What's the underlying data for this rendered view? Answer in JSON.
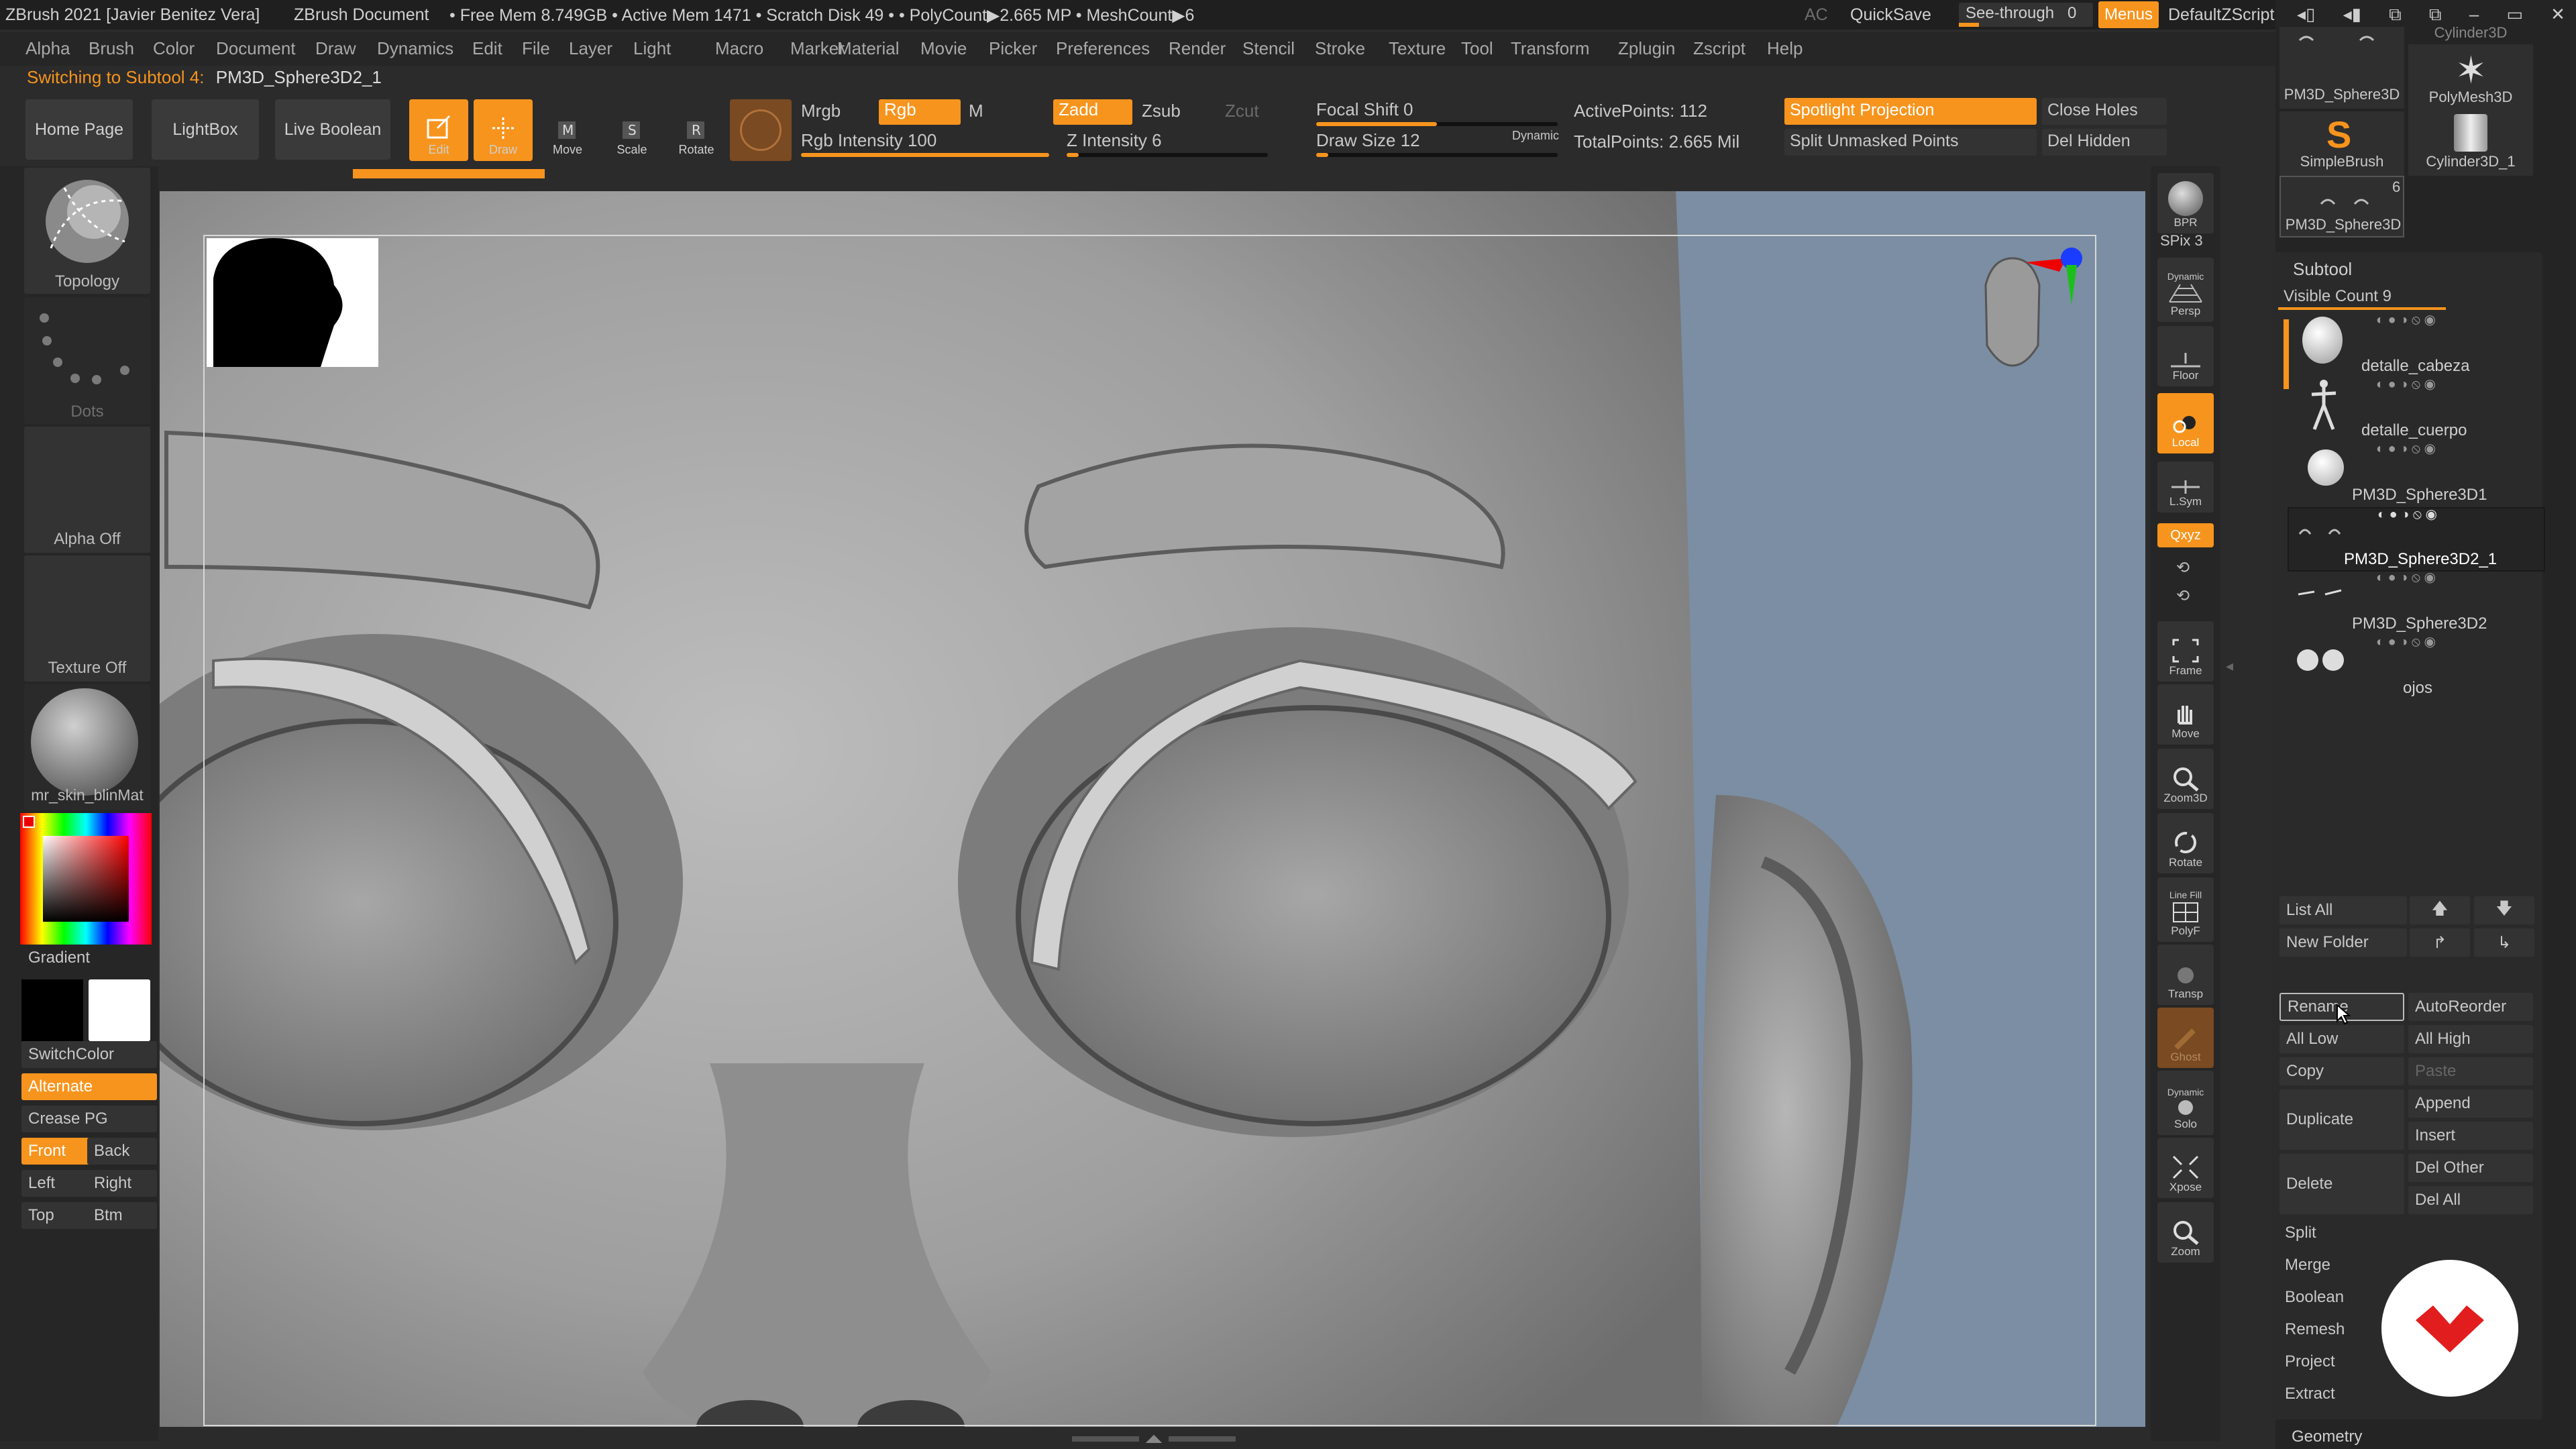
{
  "titlebar": {
    "app": "ZBrush 2021 [Javier Benitez Vera]",
    "doc": "ZBrush Document",
    "stats": "• Free Mem 8.749GB • Active Mem 1471 • Scratch Disk 49 • • PolyCount▶2.665 MP • MeshCount▶6",
    "ac": "AC",
    "quicksave": "QuickSave",
    "seethrough": "See-through",
    "seethrough_value": "0",
    "menus": "Menus",
    "script": "DefaultZScript"
  },
  "menubar": [
    "Alpha",
    "Brush",
    "Color",
    "Document",
    "Draw",
    "Dynamics",
    "Edit",
    "File",
    "Layer",
    "Light",
    "Macro",
    "Marker",
    "Material",
    "Movie",
    "Picker",
    "Preferences",
    "Render",
    "Stencil",
    "Stroke",
    "Texture",
    "Tool",
    "Transform",
    "Zplugin",
    "Zscript",
    "Help"
  ],
  "switch": {
    "label": "Switching to Subtool 4:",
    "value": "PM3D_Sphere3D2_1"
  },
  "toolbar": {
    "home": "Home Page",
    "lightbox": "LightBox",
    "liveboolean": "Live Boolean",
    "edit": "Edit",
    "draw": "Draw",
    "move": "Move",
    "scale": "Scale",
    "rotate": "Rotate",
    "mrgb": "Mrgb",
    "rgb": "Rgb",
    "m": "M",
    "rgb_intensity": "Rgb Intensity 100",
    "zadd": "Zadd",
    "zsub": "Zsub",
    "zcut": "Zcut",
    "z_intensity": "Z Intensity 6",
    "focal_shift": "Focal Shift 0",
    "draw_size": "Draw Size 12",
    "dynamic": "Dynamic",
    "active_points": "ActivePoints: 112",
    "total_points": "TotalPoints: 2.665 Mil",
    "spotlight": "Spotlight Projection",
    "split_unmasked": "Split Unmasked Points",
    "close_holes": "Close Holes",
    "del_hidden": "Del Hidden",
    "rgb_intensity_level": 1.0,
    "z_intensity_level": 0.06,
    "draw_size_level": 0.05,
    "focal_shift_level": 0.5
  },
  "leftpanel": {
    "topology": "Topology",
    "dots": "Dots",
    "alpha": "Alpha Off",
    "texture": "Texture Off",
    "material": "mr_skin_blinMat",
    "gradient": "Gradient",
    "switchcolor": "SwitchColor",
    "alternate": "Alternate",
    "crease": "Crease PG",
    "front": "Front",
    "back": "Back",
    "left": "Left",
    "right": "Right",
    "top": "Top",
    "btm": "Btm"
  },
  "righttools": {
    "bpr": "BPR",
    "spix": "SPix 3",
    "dynamic": "Dynamic",
    "persp": "Persp",
    "floor": "Floor",
    "local": "Local",
    "lsym": "L.Sym",
    "xyz": "Qxyz",
    "frame": "Frame",
    "move": "Move",
    "zoom3d": "Zoom3D",
    "rotate": "Rotate",
    "linefill": "Line Fill",
    "polyf": "PolyF",
    "transp": "Transp",
    "ghost": "Ghost",
    "dynamic2": "Dynamic",
    "solo": "Solo",
    "xpose": "Xpose",
    "zoom": "Zoom"
  },
  "rightpanel": {
    "thumbs": {
      "pm3d_sphere": "PM3D_Sphere3D",
      "polymesh": "PolyMesh3D",
      "simplebrush": "SimpleBrush",
      "cylinder": "Cylinder3D_1",
      "cylinder_top": "Cylinder3D",
      "pm3d_sphere2": "PM3D_Sphere3D",
      "count": "6"
    },
    "subtool_title": "Subtool",
    "visible_count": "Visible Count 9",
    "subtools": [
      "detalle_cabeza",
      "detalle_cuerpo",
      "PM3D_Sphere3D1",
      "PM3D_Sphere3D2_1",
      "PM3D_Sphere3D2",
      "ojos"
    ],
    "buttons": {
      "list_all": "List All",
      "new_folder": "New Folder",
      "rename": "Rename",
      "autoreorder": "AutoReorder",
      "all_low": "All Low",
      "all_high": "All High",
      "copy": "Copy",
      "paste": "Paste",
      "duplicate": "Duplicate",
      "append": "Append",
      "insert": "Insert",
      "delete": "Delete",
      "del_other": "Del Other",
      "del_all": "Del All",
      "split": "Split",
      "merge": "Merge",
      "boolean": "Boolean",
      "remesh": "Remesh",
      "project": "Project",
      "extract": "Extract",
      "geometry": "Geometry"
    }
  },
  "colors": {
    "accent": "#f7941d",
    "panel": "#2b2b2b",
    "canvas_bg": "#7b8ea3"
  }
}
